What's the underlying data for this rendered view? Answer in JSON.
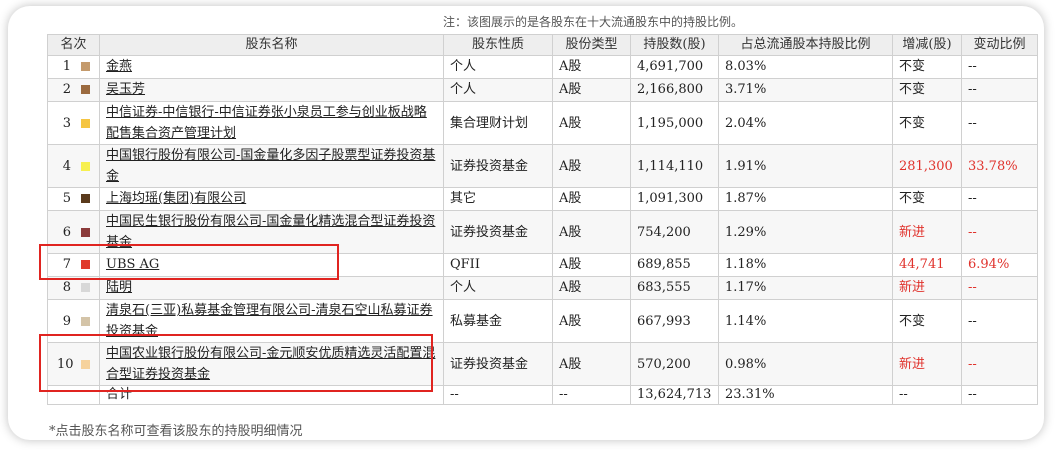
{
  "note_top": "注：该图展示的是各股东在十大流通股东中的持股比例。",
  "note_bottom": "*点击股东名称可查看该股东的持股明细情况",
  "headers": {
    "rank": "名次",
    "name": "股东名称",
    "nature": "股东性质",
    "type": "股份类型",
    "shares": "持股数(股)",
    "ratio": "占总流通股本持股比例",
    "change": "增减(股)",
    "change_ratio": "变动比例"
  },
  "rows": [
    {
      "rank": "1",
      "color": "#c49a6c",
      "name": "金燕",
      "nature": "个人",
      "type": "A股",
      "shares": "4,691,700",
      "ratio": "8.03%",
      "change": "不变",
      "change_ratio": "--"
    },
    {
      "rank": "2",
      "color": "#9b6a3f",
      "name": "吴玉芳",
      "nature": "个人",
      "type": "A股",
      "shares": "2,166,800",
      "ratio": "3.71%",
      "change": "不变",
      "change_ratio": "--"
    },
    {
      "rank": "3",
      "color": "#f5c542",
      "name": "中信证券-中信银行-中信证券张小泉员工参与创业板战略配售集合资产管理计划",
      "nature": "集合理财计划",
      "type": "A股",
      "shares": "1,195,000",
      "ratio": "2.04%",
      "change": "不变",
      "change_ratio": "--"
    },
    {
      "rank": "4",
      "color": "#f7f050",
      "name": "中国银行股份有限公司-国金量化多因子股票型证券投资基金",
      "nature": "证券投资基金",
      "type": "A股",
      "shares": "1,114,110",
      "ratio": "1.91%",
      "change": "281,300",
      "change_ratio": "33.78%"
    },
    {
      "rank": "5",
      "color": "#5a3a1c",
      "name": "上海均瑶(集团)有限公司",
      "nature": "其它",
      "type": "A股",
      "shares": "1,091,300",
      "ratio": "1.87%",
      "change": "不变",
      "change_ratio": "--"
    },
    {
      "rank": "6",
      "color": "#8b3a3a",
      "name": "中国民生银行股份有限公司-国金量化精选混合型证券投资基金",
      "nature": "证券投资基金",
      "type": "A股",
      "shares": "754,200",
      "ratio": "1.29%",
      "change": "新进",
      "change_ratio": "--"
    },
    {
      "rank": "7",
      "color": "#e03a2a",
      "name": "UBS AG",
      "nature": "QFII",
      "type": "A股",
      "shares": "689,855",
      "ratio": "1.18%",
      "change": "44,741",
      "change_ratio": "6.94%"
    },
    {
      "rank": "8",
      "color": "#d8d8d8",
      "name": "陆明",
      "nature": "个人",
      "type": "A股",
      "shares": "683,555",
      "ratio": "1.17%",
      "change": "新进",
      "change_ratio": "--"
    },
    {
      "rank": "9",
      "color": "#d4c4a8",
      "name": "清泉石(三亚)私募基金管理有限公司-清泉石空山私募证券投资基金",
      "nature": "私募基金",
      "type": "A股",
      "shares": "667,993",
      "ratio": "1.14%",
      "change": "不变",
      "change_ratio": "--"
    },
    {
      "rank": "10",
      "color": "#f6d29c",
      "name": "中国农业银行股份有限公司-金元顺安优质精选灵活配置混合型证券投资基金",
      "nature": "证券投资基金",
      "type": "A股",
      "shares": "570,200",
      "ratio": "0.98%",
      "change": "新进",
      "change_ratio": "--"
    }
  ],
  "total": {
    "label": "合计",
    "nature": "--",
    "type": "--",
    "shares": "13,624,713",
    "ratio": "23.31%",
    "change": "--",
    "change_ratio": "--"
  },
  "colors": {
    "accent_red": "#e0322c",
    "highlight_box": "#e02420",
    "header_bg": "#eeeeee"
  }
}
